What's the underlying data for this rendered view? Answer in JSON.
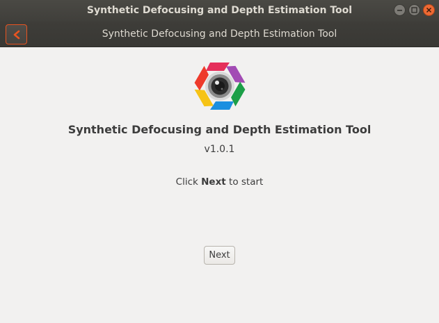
{
  "window": {
    "title": "Synthetic Defocusing and Depth Estimation Tool"
  },
  "headerbar": {
    "back_icon": "chevron-left-icon",
    "title": "Synthetic Defocusing and Depth Estimation Tool"
  },
  "window_controls": {
    "minimize_icon": "minimize-icon",
    "maximize_icon": "maximize-icon",
    "close_icon": "close-icon"
  },
  "main": {
    "logo_icon": "camera-lens-logo-icon",
    "app_title": "Synthetic Defocusing and Depth Estimation Tool",
    "version": "v1.0.1",
    "instruction_prefix": "Click",
    "instruction_bold": "Next",
    "instruction_suffix": "to start",
    "next_label": "Next"
  },
  "colors": {
    "accent": "#e95420",
    "titlebar": "#403f3b",
    "background": "#f2f1f0"
  }
}
